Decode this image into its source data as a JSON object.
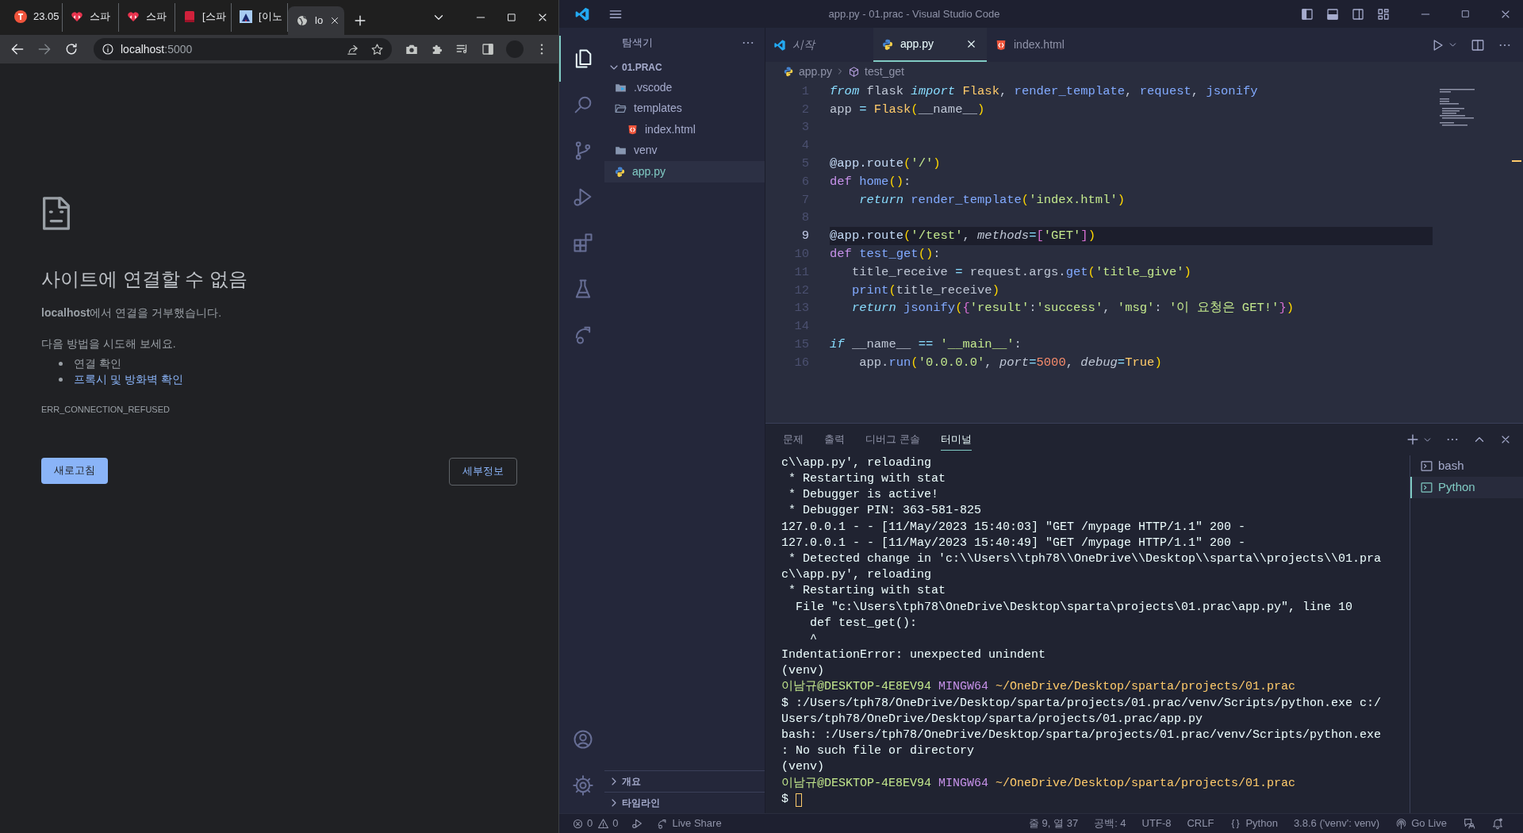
{
  "browser": {
    "tabs": [
      {
        "title": "23.05",
        "kind": "red-circle",
        "selected": false
      },
      {
        "title": "스파",
        "kind": "heart",
        "selected": false
      },
      {
        "title": "스파",
        "kind": "heart",
        "selected": false
      },
      {
        "title": "[스파",
        "kind": "book",
        "selected": false
      },
      {
        "title": "[이노",
        "kind": "image",
        "selected": false
      },
      {
        "title": "lo",
        "kind": "globe",
        "selected": true
      }
    ],
    "navigation": [
      {
        "kind": "back",
        "disabled": false
      },
      {
        "kind": "forward",
        "disabled": true
      },
      {
        "kind": "reload",
        "disabled": false
      }
    ],
    "address": {
      "host": "localhost",
      "port": ":5000"
    },
    "error_page": {
      "heading": "사이트에 연결할 수 없음",
      "message": "**localhost**에서 연결을 거부했습니다.",
      "suggestion_intro": "다음 방법을 시도해 보세요.",
      "suggestions": [
        {
          "text": "연결 확인",
          "kind": "text"
        },
        {
          "text": "프록시 및 방화벽 확인",
          "kind": "link"
        }
      ],
      "error_code": "ERR_CONNECTION_REFUSED",
      "buttons": [
        {
          "label": "새로고침",
          "kind": "primary"
        },
        {
          "label": "세부정보",
          "kind": "secondary"
        }
      ]
    }
  },
  "vscode": {
    "title": "app.py - 01.prac - Visual Studio Code",
    "activity_bar": [
      {
        "kind": "explorer",
        "selected": true
      },
      {
        "kind": "search",
        "selected": false
      },
      {
        "kind": "source-control",
        "selected": false
      },
      {
        "kind": "run-debug",
        "selected": false
      },
      {
        "kind": "extensions",
        "selected": false
      },
      {
        "kind": "testing",
        "selected": false
      },
      {
        "kind": "live-share",
        "selected": false
      },
      {
        "kind": "account",
        "selected": false
      },
      {
        "kind": "settings",
        "selected": false
      }
    ],
    "explorer": {
      "title": "탐색기",
      "folder": {
        "name": "01.PRAC",
        "expanded": true,
        "items": [
          {
            "name": ".vscode",
            "kind": "vscode-folder",
            "expanded": false,
            "selected": false
          },
          {
            "name": "templates",
            "kind": "folder",
            "expanded": true,
            "selected": false,
            "children": [
              {
                "name": "index.html",
                "kind": "html",
                "selected": false
              }
            ]
          },
          {
            "name": "venv",
            "kind": "folder",
            "expanded": false,
            "selected": false
          },
          {
            "name": "app.py",
            "kind": "python",
            "selected": true
          }
        ]
      },
      "sections": [
        {
          "name": "개요",
          "expanded": false
        },
        {
          "name": "타임라인",
          "expanded": false
        }
      ]
    },
    "editor_tabs": [
      {
        "label": "시작",
        "kind": "vscode",
        "selected": false,
        "preview": true
      },
      {
        "label": "app.py",
        "kind": "python",
        "selected": true,
        "preview": false
      },
      {
        "label": "index.html",
        "kind": "html",
        "selected": false,
        "preview": false
      }
    ],
    "breadcrumb": [
      {
        "text": "app.py",
        "kind": "python"
      },
      {
        "text": "test_get",
        "kind": "method"
      }
    ],
    "code_lines": [
      {
        "number": "1",
        "current": false,
        "tokens": [
          {
            "text": "from",
            "kind": "kw"
          },
          {
            "text": " flask ",
            "kind": "plain"
          },
          {
            "text": "import",
            "kind": "kw"
          },
          {
            "text": " Flask",
            "kind": "cls"
          },
          {
            "text": ", ",
            "kind": "plain"
          },
          {
            "text": "render_template",
            "kind": "fn"
          },
          {
            "text": ", ",
            "kind": "plain"
          },
          {
            "text": "request",
            "kind": "fn"
          },
          {
            "text": ", ",
            "kind": "plain"
          },
          {
            "text": "jsonify",
            "kind": "fn"
          }
        ]
      },
      {
        "number": "2",
        "current": false,
        "tokens": [
          {
            "text": "app ",
            "kind": "plain"
          },
          {
            "text": "=",
            "kind": "op"
          },
          {
            "text": " Flask",
            "kind": "cls"
          },
          {
            "text": "(",
            "kind": "punc"
          },
          {
            "text": "__name__",
            "kind": "plain"
          },
          {
            "text": ")",
            "kind": "punc"
          }
        ]
      },
      {
        "number": "3",
        "current": false
      },
      {
        "number": "4",
        "current": false
      },
      {
        "number": "5",
        "current": false,
        "tokens": [
          {
            "text": "@app.route",
            "kind": "deco"
          },
          {
            "text": "(",
            "kind": "punc"
          },
          {
            "text": "'/'",
            "kind": "str"
          },
          {
            "text": ")",
            "kind": "punc"
          }
        ]
      },
      {
        "number": "6",
        "current": false,
        "tokens": [
          {
            "text": "def",
            "kind": "def"
          },
          {
            "text": " home",
            "kind": "fn"
          },
          {
            "text": "()",
            "kind": "punc"
          },
          {
            "text": ":",
            "kind": "plain"
          }
        ]
      },
      {
        "number": "7",
        "current": false,
        "tokens": [
          {
            "text": "    return",
            "kind": "kw"
          },
          {
            "text": " render_template",
            "kind": "fn"
          },
          {
            "text": "(",
            "kind": "punc"
          },
          {
            "text": "'index.html'",
            "kind": "str"
          },
          {
            "text": ")",
            "kind": "punc"
          }
        ]
      },
      {
        "number": "8",
        "current": false
      },
      {
        "number": "9",
        "current": true,
        "tokens": [
          {
            "text": "@app.route",
            "kind": "deco"
          },
          {
            "text": "(",
            "kind": "punc"
          },
          {
            "text": "'/test'",
            "kind": "str"
          },
          {
            "text": ", ",
            "kind": "plain"
          },
          {
            "text": "methods",
            "kind": "param"
          },
          {
            "text": "=",
            "kind": "op"
          },
          {
            "text": "[",
            "kind": "punc2"
          },
          {
            "text": "'GET'",
            "kind": "str"
          },
          {
            "text": "]",
            "kind": "punc2"
          },
          {
            "text": ")",
            "kind": "punc"
          }
        ]
      },
      {
        "number": "10",
        "current": false,
        "tokens": [
          {
            "text": "def",
            "kind": "def"
          },
          {
            "text": " test_get",
            "kind": "fn"
          },
          {
            "text": "()",
            "kind": "punc"
          },
          {
            "text": ":",
            "kind": "plain"
          }
        ]
      },
      {
        "number": "11",
        "current": false,
        "tokens": [
          {
            "text": "   title_receive ",
            "kind": "plain"
          },
          {
            "text": "=",
            "kind": "op"
          },
          {
            "text": " request.args.",
            "kind": "plain"
          },
          {
            "text": "get",
            "kind": "fn"
          },
          {
            "text": "(",
            "kind": "punc"
          },
          {
            "text": "'title_give'",
            "kind": "str"
          },
          {
            "text": ")",
            "kind": "punc"
          }
        ]
      },
      {
        "number": "12",
        "current": false,
        "tokens": [
          {
            "text": "   print",
            "kind": "fn"
          },
          {
            "text": "(",
            "kind": "punc"
          },
          {
            "text": "title_receive",
            "kind": "plain"
          },
          {
            "text": ")",
            "kind": "punc"
          }
        ]
      },
      {
        "number": "13",
        "current": false,
        "tokens": [
          {
            "text": "   return",
            "kind": "kw"
          },
          {
            "text": " jsonify",
            "kind": "fn"
          },
          {
            "text": "(",
            "kind": "punc"
          },
          {
            "text": "{",
            "kind": "punc2"
          },
          {
            "text": "'result'",
            "kind": "str"
          },
          {
            "text": ":",
            "kind": "plain"
          },
          {
            "text": "'success'",
            "kind": "str"
          },
          {
            "text": ", ",
            "kind": "plain"
          },
          {
            "text": "'msg'",
            "kind": "str"
          },
          {
            "text": ": ",
            "kind": "plain"
          },
          {
            "text": "'이 요청은 GET!'",
            "kind": "str"
          },
          {
            "text": "}",
            "kind": "punc2"
          },
          {
            "text": ")",
            "kind": "punc"
          }
        ]
      },
      {
        "number": "14",
        "current": false
      },
      {
        "number": "15",
        "current": false,
        "tokens": [
          {
            "text": "if",
            "kind": "kw"
          },
          {
            "text": " __name__ ",
            "kind": "plain"
          },
          {
            "text": "==",
            "kind": "op"
          },
          {
            "text": " '__main__'",
            "kind": "str"
          },
          {
            "text": ":",
            "kind": "plain"
          }
        ]
      },
      {
        "number": "16",
        "current": false,
        "tokens": [
          {
            "text": "    app.",
            "kind": "plain"
          },
          {
            "text": "run",
            "kind": "fn"
          },
          {
            "text": "(",
            "kind": "punc"
          },
          {
            "text": "'0.0.0.0'",
            "kind": "str"
          },
          {
            "text": ", ",
            "kind": "plain"
          },
          {
            "text": "port",
            "kind": "param"
          },
          {
            "text": "=",
            "kind": "op"
          },
          {
            "text": "5000",
            "kind": "num"
          },
          {
            "text": ", ",
            "kind": "plain"
          },
          {
            "text": "debug",
            "kind": "param"
          },
          {
            "text": "=",
            "kind": "op"
          },
          {
            "text": "True",
            "kind": "cls"
          },
          {
            "text": ")",
            "kind": "punc"
          }
        ]
      }
    ],
    "panel": {
      "tabs": [
        {
          "label": "문제",
          "selected": false
        },
        {
          "label": "출력",
          "selected": false
        },
        {
          "label": "디버그 콘솔",
          "selected": false
        },
        {
          "label": "터미널",
          "selected": true
        }
      ],
      "terminal_lines": [
        {
          "text": "c\\\\app.py', reloading"
        },
        {
          "text": " * Restarting with stat"
        },
        {
          "text": " * Debugger is active!"
        },
        {
          "text": " * Debugger PIN: 363-581-825"
        },
        {
          "text": "127.0.0.1 - - [11/May/2023 15:40:03] \"GET /mypage HTTP/1.1\" 200 -"
        },
        {
          "text": "127.0.0.1 - - [11/May/2023 15:40:49] \"GET /mypage HTTP/1.1\" 200 -"
        },
        {
          "text": " * Detected change in 'c:\\\\Users\\\\tph78\\\\OneDrive\\\\Desktop\\\\sparta\\\\projects\\\\01.pra"
        },
        {
          "text": "c\\\\app.py', reloading"
        },
        {
          "text": " * Restarting with stat"
        },
        {
          "text": "  File \"c:\\Users\\tph78\\OneDrive\\Desktop\\sparta\\projects\\01.prac\\app.py\", line 10"
        },
        {
          "text": "    def test_get():"
        },
        {
          "text": "    ^"
        },
        {
          "text": "IndentationError: unexpected unindent"
        },
        {
          "text": "(venv)"
        },
        {
          "parts": [
            {
              "text": "이남규@DESKTOP-4E8EV94",
              "kind": "user"
            },
            {
              "text": " MINGW64",
              "kind": "system"
            },
            {
              "text": " ~/OneDrive/Desktop/sparta/projects/01.prac",
              "kind": "path"
            }
          ]
        },
        {
          "text": "$ :/Users/tph78/OneDrive/Desktop/sparta/projects/01.prac/venv/Scripts/python.exe c:/"
        },
        {
          "text": "Users/tph78/OneDrive/Desktop/sparta/projects/01.prac/app.py"
        },
        {
          "text": "bash: :/Users/tph78/OneDrive/Desktop/sparta/projects/01.prac/venv/Scripts/python.exe"
        },
        {
          "text": ": No such file or directory"
        },
        {
          "text": "(venv)"
        },
        {
          "parts": [
            {
              "text": "이남규@DESKTOP-4E8EV94",
              "kind": "user"
            },
            {
              "text": " MINGW64",
              "kind": "system"
            },
            {
              "text": " ~/OneDrive/Desktop/sparta/projects/01.prac",
              "kind": "path"
            }
          ]
        },
        {
          "text": "$",
          "cursor": true
        }
      ],
      "terminals": [
        {
          "label": "bash",
          "selected": false
        },
        {
          "label": "Python",
          "selected": true
        }
      ]
    },
    "status_bar": {
      "left": [
        {
          "kind": "problems",
          "errors": "0",
          "warnings": "0"
        },
        {
          "kind": "debug"
        },
        {
          "kind": "live-share",
          "text": "Live Share"
        }
      ],
      "right": [
        {
          "kind": "text",
          "text": "줄 9, 열 37"
        },
        {
          "kind": "text",
          "text": "공백: 4"
        },
        {
          "kind": "text",
          "text": "UTF-8"
        },
        {
          "kind": "text",
          "text": "CRLF"
        },
        {
          "kind": "language",
          "text": "Python"
        },
        {
          "kind": "text",
          "text": "3.8.6 ('venv': venv)"
        },
        {
          "kind": "go-live",
          "text": "Go Live"
        },
        {
          "kind": "feedback"
        },
        {
          "kind": "bell"
        }
      ]
    }
  }
}
